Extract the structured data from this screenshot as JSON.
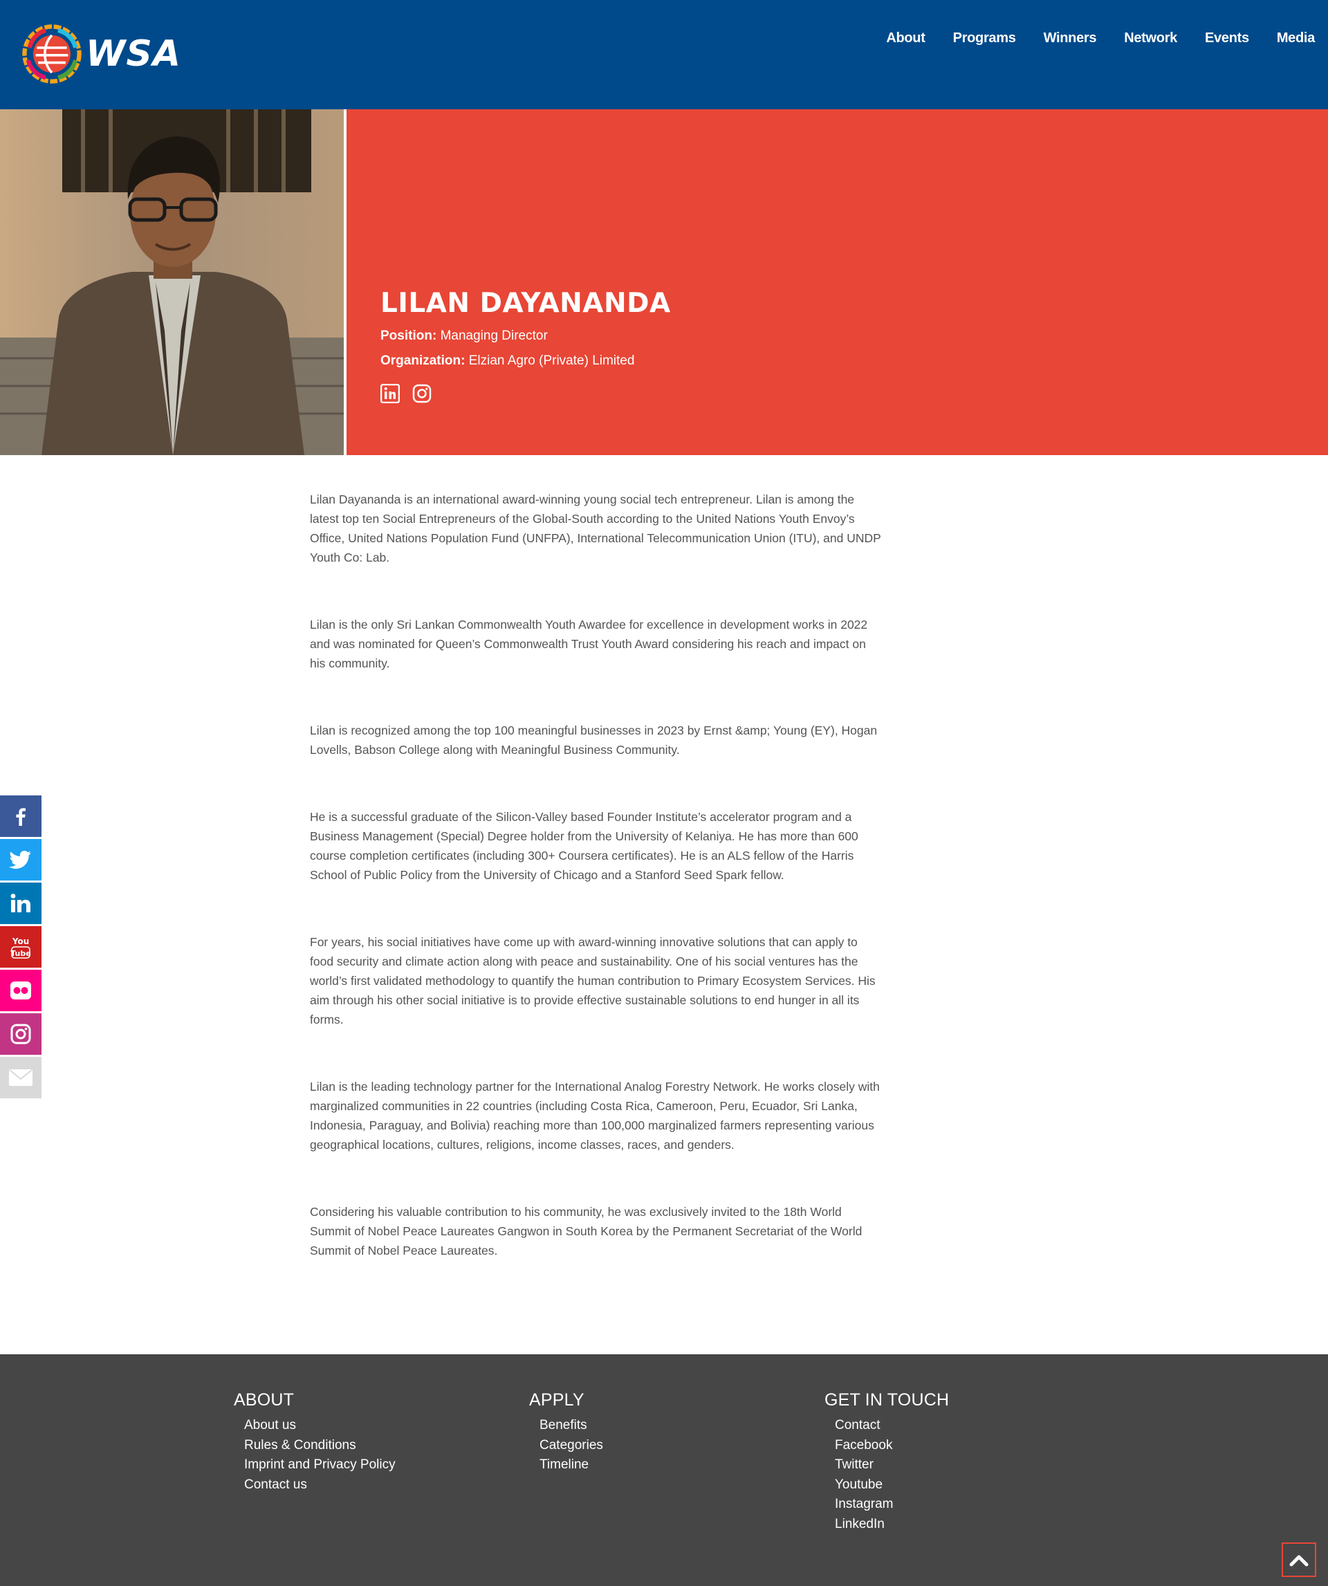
{
  "header": {
    "logo_text": "WSA",
    "nav": [
      "About",
      "Programs",
      "Winners",
      "Network",
      "Events",
      "Media"
    ]
  },
  "profile": {
    "name": "LILAN DAYANANDA",
    "position_label": "Position:",
    "position_value": "Managing Director",
    "organization_label": "Organization:",
    "organization_value": "Elzian Agro (Private) Limited",
    "social_icons": [
      "linkedin-icon",
      "instagram-icon"
    ]
  },
  "bio": [
    "Lilan Dayananda is an international award-winning young social tech entrepreneur. Lilan is among the latest top ten Social Entrepreneurs of the Global-South according to the United Nations Youth Envoy’s Office, United Nations Population Fund (UNFPA), International Telecommunication Union (ITU), and UNDP Youth Co: Lab.",
    "Lilan is the only Sri Lankan Commonwealth Youth Awardee for excellence in development works in 2022 and was nominated for Queen’s Commonwealth Trust Youth Award considering his reach and impact on his community.",
    "Lilan is recognized among the top 100 meaningful businesses in 2023 by Ernst &amp; Young (EY), Hogan Lovells, Babson College along with Meaningful Business Community.",
    "He is a successful graduate of the Silicon-Valley based Founder Institute’s accelerator program and a Business Management (Special) Degree holder from the University of Kelaniya. He has more than 600 course completion certificates (including 300+ Coursera certificates). He is an ALS fellow of the Harris School of Public Policy from the University of Chicago and a Stanford Seed Spark fellow.",
    "For years, his social initiatives have come up with award-winning innovative solutions that can apply to food security and climate action along with peace and sustainability. One of his social ventures has the world’s first validated methodology to quantify the human contribution to Primary Ecosystem Services. His aim through his other social initiative is to provide effective sustainable solutions to end hunger in all its forms.",
    "Lilan is the leading technology partner for the International Analog Forestry Network. He works closely with marginalized communities in 22 countries (including Costa Rica, Cameroon, Peru, Ecuador, Sri Lanka, Indonesia, Paraguay, and Bolivia) reaching more than 100,000 marginalized farmers representing various geographical locations, cultures, religions, income classes, races, and genders.",
    "Considering his valuable contribution to his community, he was exclusively invited to the 18th World Summit of Nobel Peace Laureates Gangwon in South Korea by the Permanent Secretariat of the World Summit of Nobel Peace Laureates."
  ],
  "share_bar": [
    {
      "icon": "facebook-icon",
      "color": "#3b5998"
    },
    {
      "icon": "twitter-icon",
      "color": "#1da1f2"
    },
    {
      "icon": "linkedin-icon",
      "color": "#0077b5"
    },
    {
      "icon": "youtube-icon",
      "color": "#cd201f"
    },
    {
      "icon": "flickr-icon",
      "color": "#ff0084"
    },
    {
      "icon": "instagram-icon",
      "color": "#c13584"
    },
    {
      "icon": "email-icon",
      "color": "#d9d9d9"
    }
  ],
  "footer": {
    "about": {
      "title": "ABOUT",
      "links": [
        "About us",
        "Rules & Conditions",
        "Imprint and Privacy Policy",
        "Contact us"
      ]
    },
    "apply": {
      "title": "APPLY",
      "links": [
        "Benefits",
        "Categories",
        "Timeline"
      ]
    },
    "contact": {
      "title": "GET IN TOUCH",
      "links": [
        "Contact",
        "Facebook",
        "Twitter",
        "Youtube",
        "Instagram",
        "LinkedIn"
      ]
    }
  },
  "colors": {
    "header": "#004a8b",
    "hero": "#e84636",
    "footer": "#464646"
  }
}
